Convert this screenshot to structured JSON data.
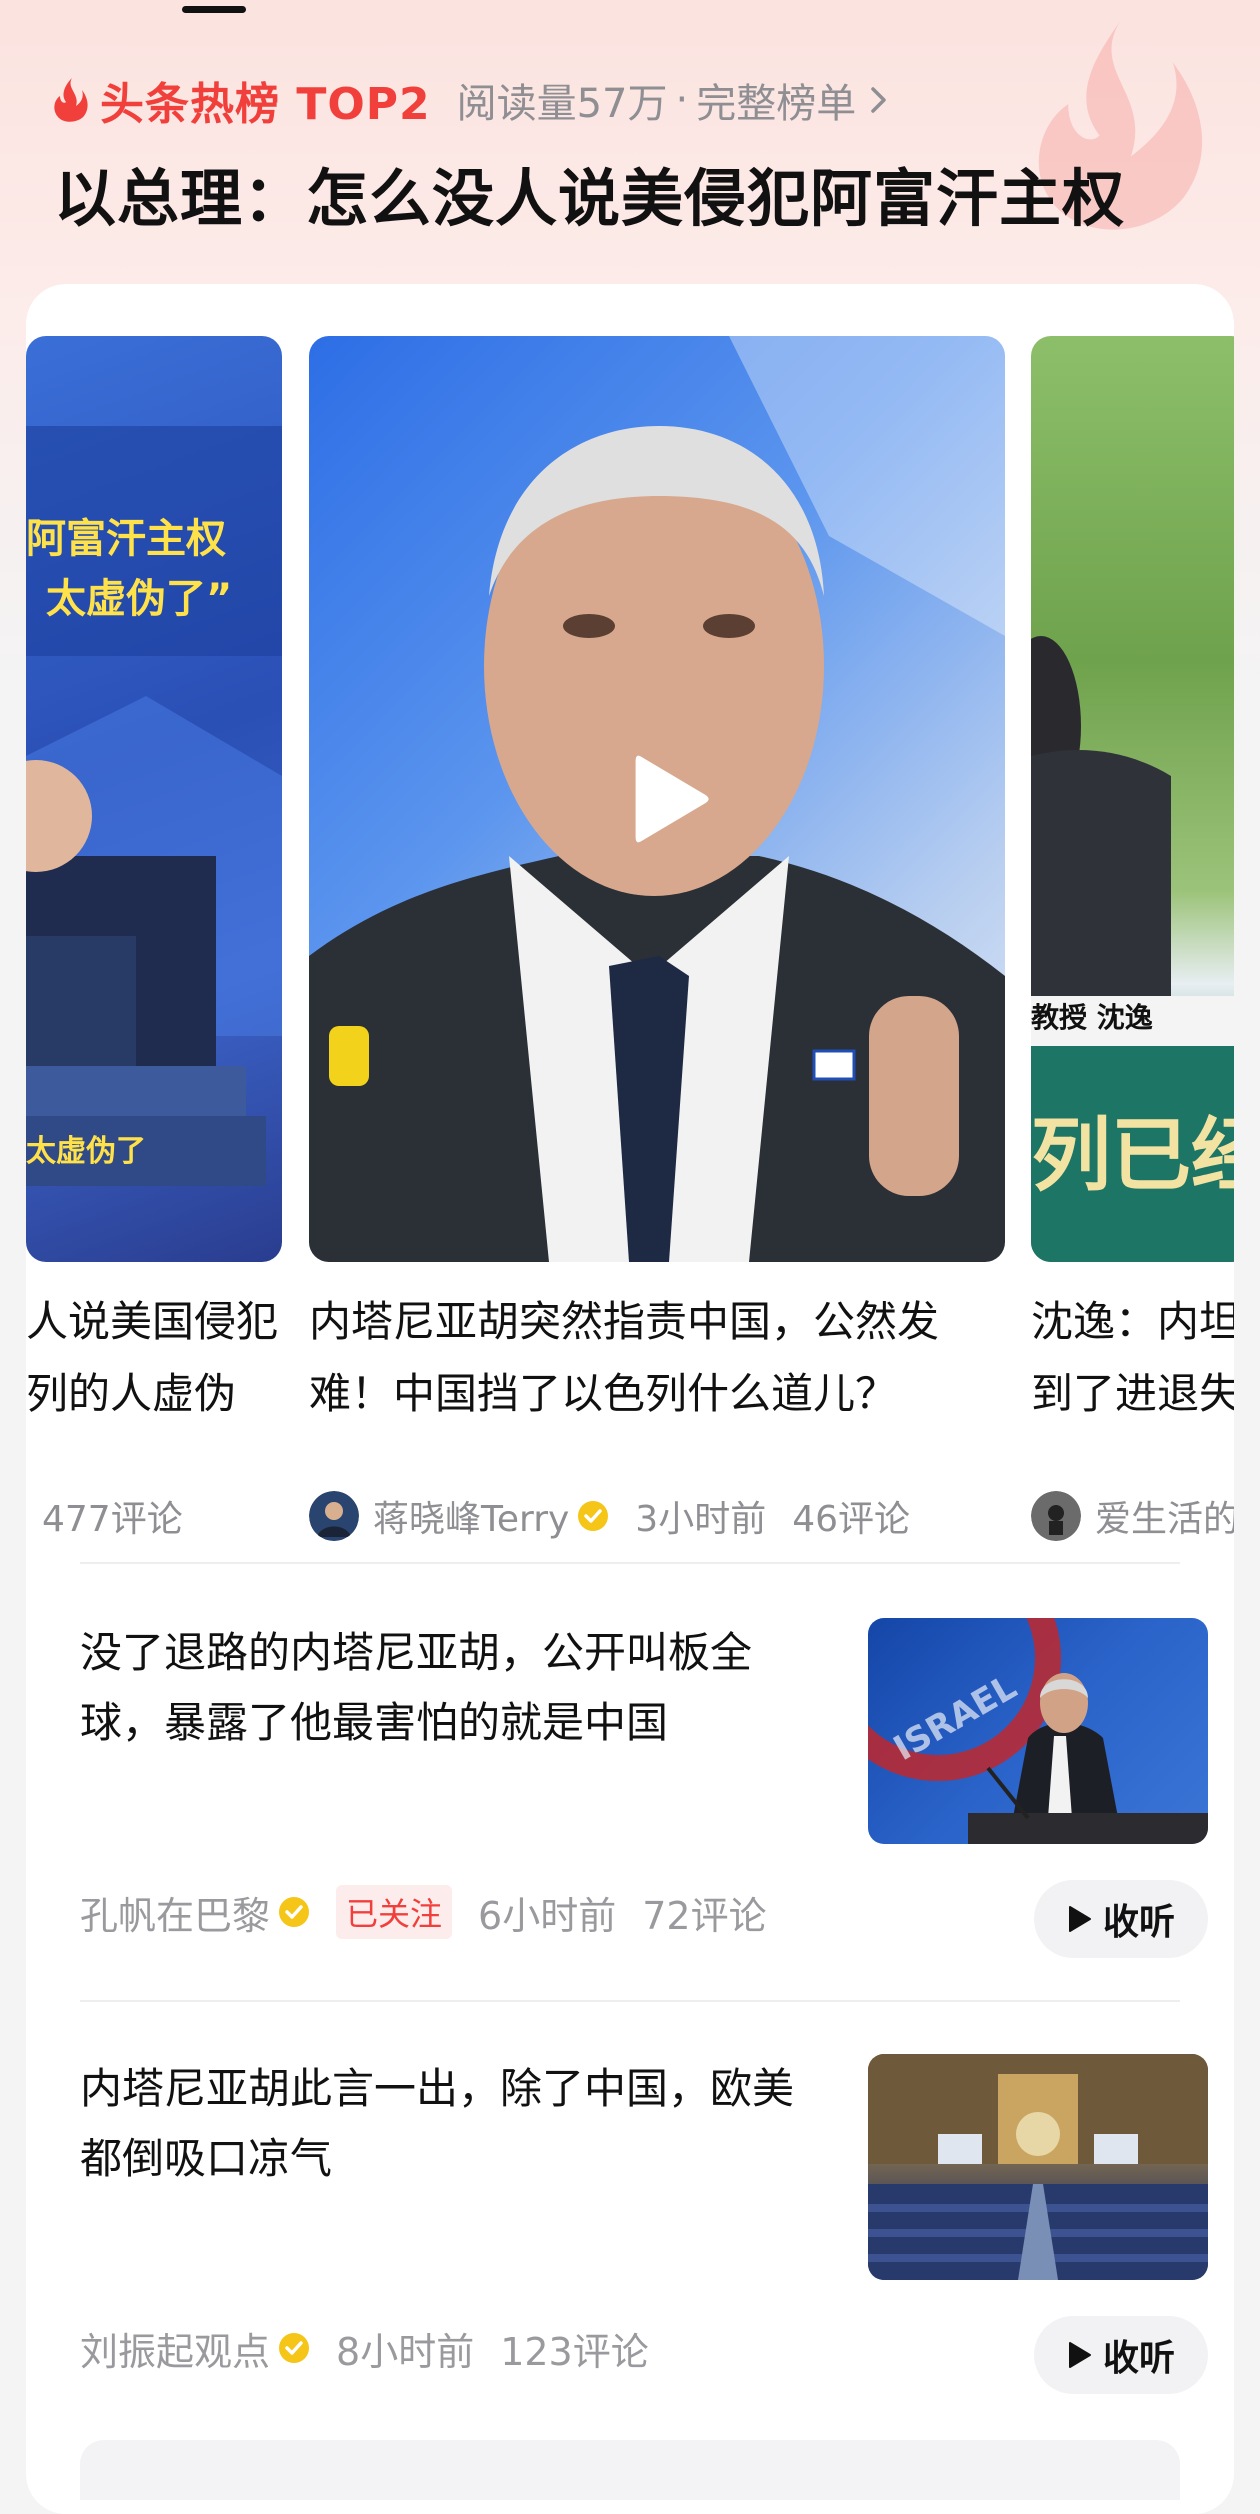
{
  "header": {
    "hot_label": "头条热榜 TOP2",
    "reads": "阅读量57万",
    "separator": "·",
    "full_list": "完整榜单",
    "headline": "以总理：怎么没人说美侵犯阿富汗主权"
  },
  "carousel": {
    "left_card": {
      "thumb_text_1": "阿富汗主权",
      "thumb_text_2": "太虚伪了”",
      "thumb_text_3": "太虚伪了",
      "title_line1": "人说美国侵犯",
      "title_line2": "列的人虚伪",
      "comments": "477评论"
    },
    "center_card": {
      "title": "内塔尼亚胡突然指责中国，公然发难！中国挡了以色列什么道儿？",
      "author": "蒋晓峰Terry",
      "time": "3小时前",
      "comments": "46评论"
    },
    "right_card": {
      "thumb_text_1": "教授 沈逸",
      "thumb_text_2": "列已经",
      "title_line1": "沈逸：内坦",
      "title_line2": "到了进退失",
      "author": "爱生活的"
    }
  },
  "feed": [
    {
      "title": "没了退路的内塔尼亚胡，公开叫板全球，暴露了他最害怕的就是中国",
      "author": "孔帆在巴黎",
      "followed": "已关注",
      "time": "6小时前",
      "comments": "72评论",
      "listen": "收听",
      "img_text": "ISRAEL"
    },
    {
      "title": "内塔尼亚胡此言一出，除了中国，欧美都倒吸口凉气",
      "author": "刘振起观点",
      "time": "8小时前",
      "comments": "123评论",
      "listen": "收听"
    }
  ],
  "colors": {
    "accent": "#f1403c",
    "verified": "#f5c518",
    "muted": "#8e8e93"
  },
  "icons": [
    "flame-icon",
    "chevron-right-icon",
    "play-icon",
    "verified-icon",
    "listen-play-icon"
  ]
}
